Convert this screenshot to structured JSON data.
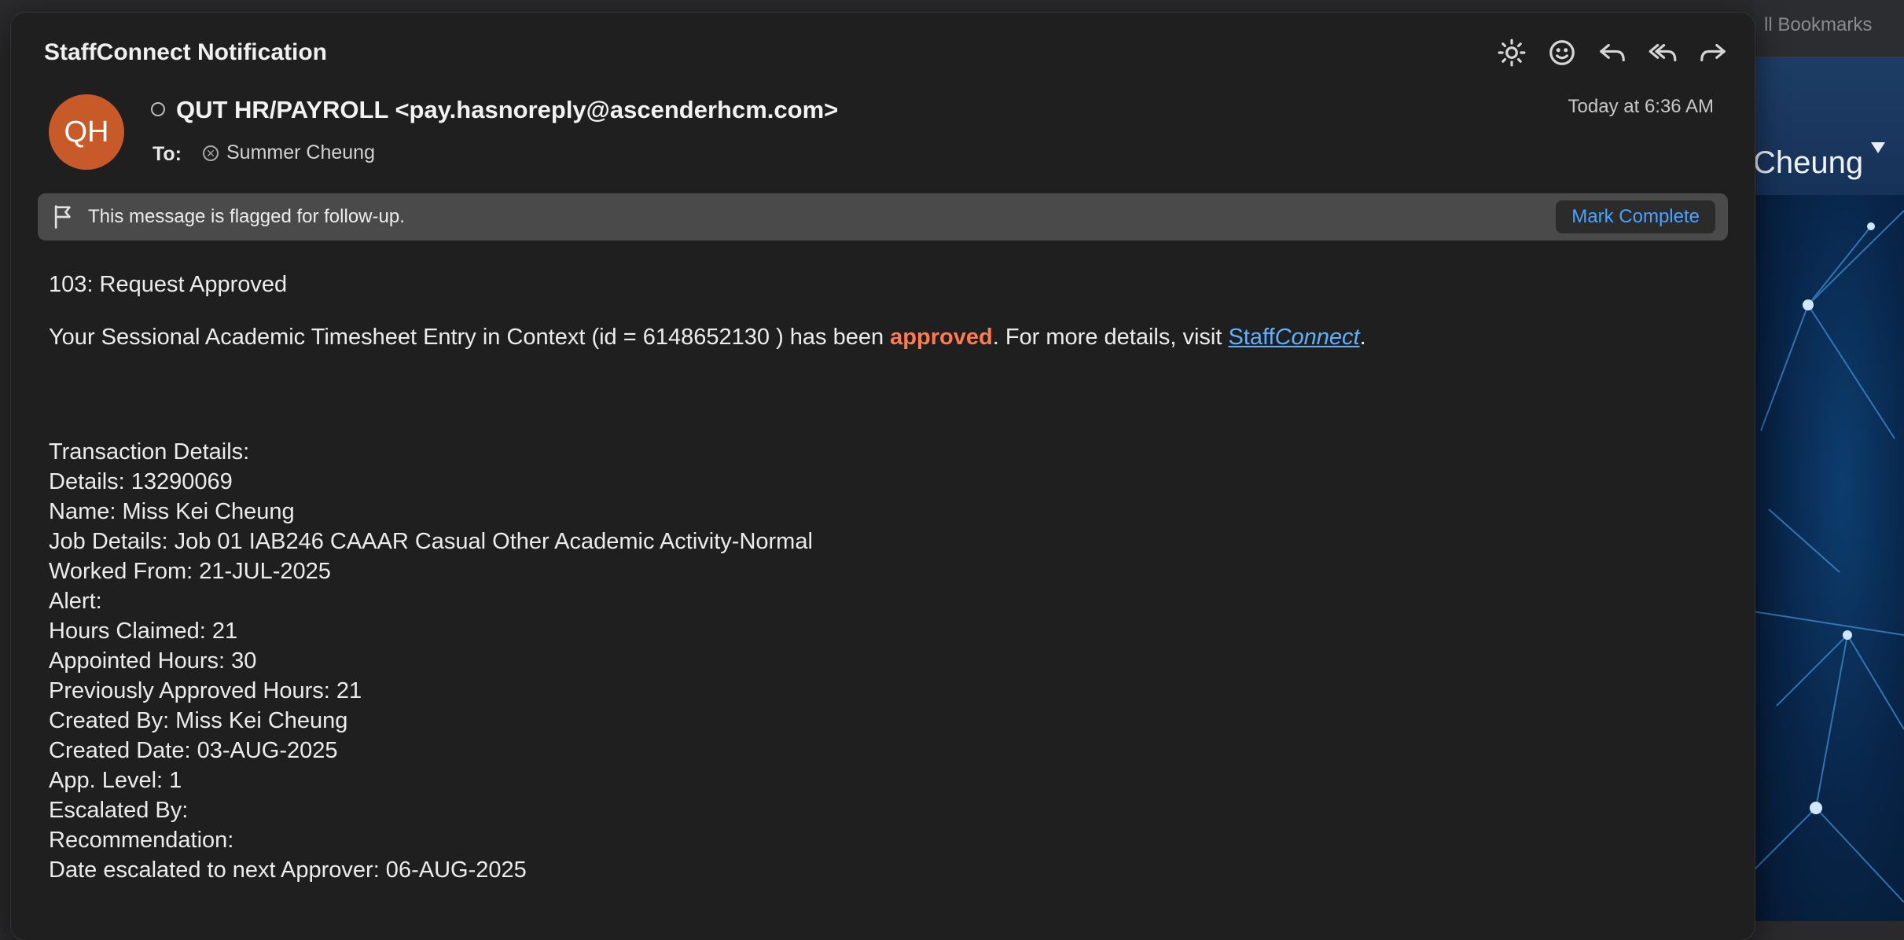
{
  "background_window": {
    "bookmarks_label": "ll Bookmarks",
    "name_fragment": "Cheung"
  },
  "mail": {
    "subject": "StaffConnect Notification",
    "toolbar": {
      "icons": [
        "brightness-icon",
        "emoji-icon",
        "reply-icon",
        "reply-all-icon",
        "forward-icon"
      ]
    },
    "avatar_initials": "QH",
    "sender": "QUT HR/PAYROLL <pay.hasnoreply@ascenderhcm.com>",
    "to_label": "To:",
    "recipient": "Summer Cheung",
    "timestamp": "Today at 6:36 AM",
    "flag_text": "This message is flagged for follow-up.",
    "mark_complete_label": "Mark Complete",
    "body": {
      "title": "103: Request Approved",
      "intro_before": "Your Sessional Academic Timesheet Entry in Context (id = 6148652130 ) has been ",
      "intro_approved": "approved",
      "intro_middle": ". For more details, visit ",
      "link_part1": "Staff",
      "link_part2": "Connect",
      "intro_end": ".",
      "details": [
        "Transaction Details:",
        "Details: 13290069",
        "Name: Miss Kei Cheung",
        "Job Details: Job 01 IAB246 CAAAR Casual Other Academic Activity-Normal",
        "Worked From: 21-JUL-2025",
        "Alert:",
        "Hours Claimed: 21",
        "Appointed Hours: 30",
        "Previously Approved Hours: 21",
        "Created By: Miss Kei Cheung",
        "Created Date: 03-AUG-2025",
        "App. Level: 1",
        "Escalated By:",
        "Recommendation:",
        "Date escalated to next Approver: 06-AUG-2025"
      ]
    }
  },
  "colors": {
    "accent_link": "#5fb0ff",
    "approved": "#ff7a50",
    "avatar": "#c85a2a",
    "button_text": "#4aa3ff"
  }
}
